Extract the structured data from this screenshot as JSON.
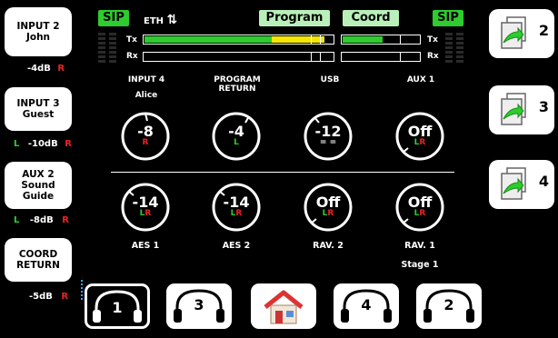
{
  "left_panel": [
    {
      "label": "INPUT 2\nJohn",
      "level_l": "",
      "level_value": "-4dB",
      "level_r": "R"
    },
    {
      "label": "INPUT 3\nGuest",
      "level_l": "L",
      "level_value": "-10dB",
      "level_r": "R"
    },
    {
      "label": "AUX 2\nSound\nGuide",
      "level_l": "L",
      "level_value": "-8dB",
      "level_r": "R"
    },
    {
      "label": "COORD\nRETURN",
      "level_l": "",
      "level_value": "-5dB",
      "level_r": "R"
    }
  ],
  "header": {
    "sip_left": "SIP",
    "eth": "ETH",
    "program": "Program",
    "coord": "Coord",
    "sip_right": "SIP",
    "tx": "Tx",
    "rx": "Rx"
  },
  "meters": {
    "program_tx_green": 0.68,
    "program_tx_yellow": 0.28,
    "coord_tx_green": 0.52
  },
  "columns": [
    {
      "label": "INPUT 4",
      "sub": "Alice"
    },
    {
      "label": "PROGRAM\nRETURN",
      "sub": ""
    },
    {
      "label": "USB",
      "sub": ""
    },
    {
      "label": "AUX 1",
      "sub": ""
    }
  ],
  "knobs_top": [
    {
      "value": "-8",
      "l": "",
      "r": "R",
      "w": ""
    },
    {
      "value": "-4",
      "l": "L",
      "r": "",
      "w": ""
    },
    {
      "value": "-12",
      "l": "",
      "r": "",
      "w": "= ="
    },
    {
      "value": "Off",
      "l": "L",
      "r": "R",
      "w": ""
    }
  ],
  "knobs_bottom": [
    {
      "value": "-14",
      "l": "L",
      "r": "R",
      "w": ""
    },
    {
      "value": "-14",
      "l": "L",
      "r": "R",
      "w": ""
    },
    {
      "value": "Off",
      "l": "L",
      "r": "R",
      "w": ""
    },
    {
      "value": "Off",
      "l": "L",
      "r": "R",
      "w": ""
    }
  ],
  "bottom_labels": [
    {
      "label": "AES 1",
      "sub": ""
    },
    {
      "label": "AES 2",
      "sub": ""
    },
    {
      "label": "RAV. 2",
      "sub": ""
    },
    {
      "label": "RAV. 1",
      "sub": "Stage 1"
    }
  ],
  "right_panel": [
    {
      "num": "2"
    },
    {
      "num": "3"
    },
    {
      "num": "4"
    }
  ],
  "bottom_nav": [
    {
      "num": "1",
      "selected": true
    },
    {
      "num": "3",
      "selected": false
    },
    {
      "num": "home",
      "selected": false
    },
    {
      "num": "4",
      "selected": false
    },
    {
      "num": "2",
      "selected": false
    }
  ],
  "colors": {
    "green": "#2ecc2e",
    "yellow": "#f5e600",
    "pale_green": "#b9f0b9",
    "red": "#e22"
  }
}
